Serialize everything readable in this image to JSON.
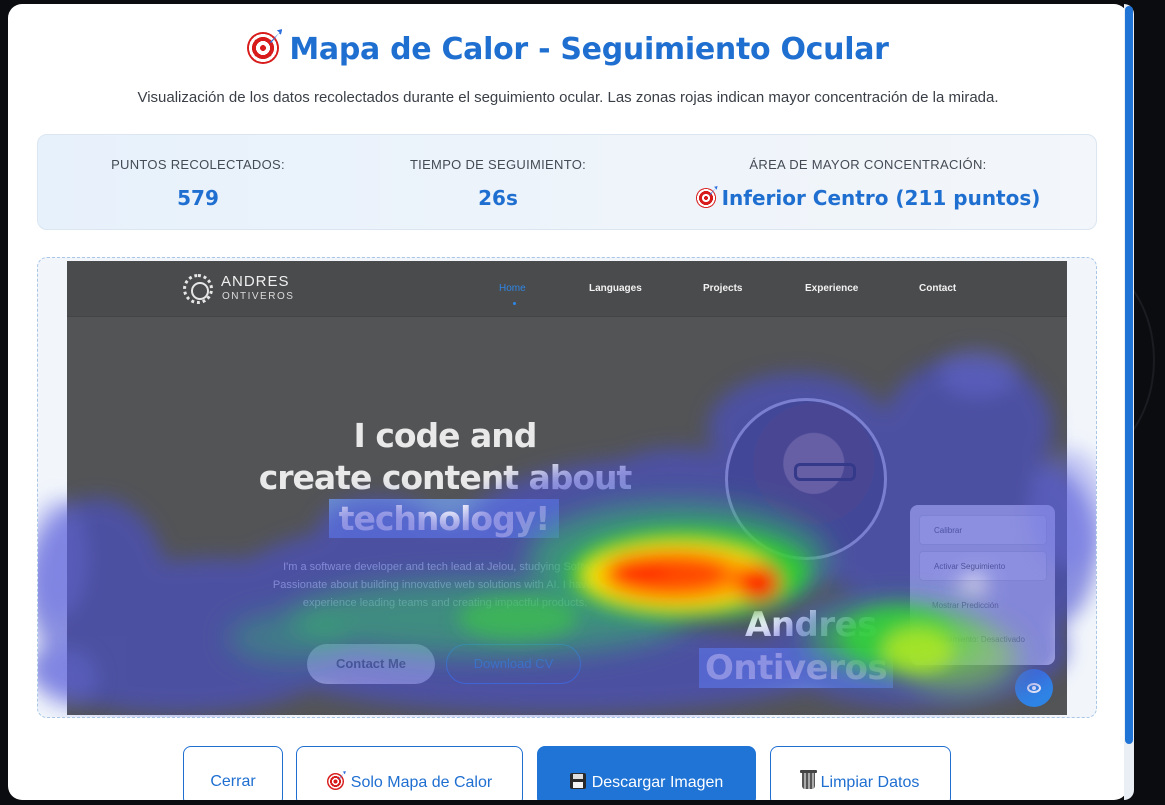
{
  "modal": {
    "title": "Mapa de Calor - Seguimiento Ocular",
    "title_icon": "target-icon",
    "subtitle": "Visualización de los datos recolectados durante el seguimiento ocular. Las zonas rojas indican mayor concentración de la mirada."
  },
  "stats": {
    "points_label": "PUNTOS RECOLECTADOS:",
    "points_value": "579",
    "time_label": "TIEMPO DE SEGUIMIENTO:",
    "time_value": "26s",
    "area_label": "ÁREA DE MAYOR CONCENTRACIÓN:",
    "area_value": "Inferior Centro (211 puntos)"
  },
  "site": {
    "logo_name": "ANDRES",
    "logo_sub": "ONTIVEROS",
    "nav": [
      "Home",
      "Languages",
      "Projects",
      "Experience",
      "Contact"
    ],
    "hero_line1": "I code and",
    "hero_line2": "create content about",
    "hero_line3": "technology!",
    "hero_p1": "I'm a software developer and tech lead at Jelou, studying Software",
    "hero_p2": "Passionate about building innovative web solutions with AI. I have over",
    "hero_p3": "experience leading teams and creating impactful products.",
    "btn_contact": "Contact Me",
    "btn_cv": "Download CV",
    "name_1": "Andres",
    "name_2": "Ontiveros",
    "panel_calibrate": "Calibrar",
    "panel_tracking": "Activar Seguimiento",
    "panel_prediction": "Mostrar Predicción",
    "panel_status": "Seguimiento: Desactivado"
  },
  "actions": {
    "close": "Cerrar",
    "heatmap_only": "Solo Mapa de Calor",
    "download": "Descargar Imagen",
    "clear": "Limpiar Datos"
  },
  "colors": {
    "accent": "#1f6fd1",
    "heat_low": "#4a4fd0",
    "heat_mid": "#2fd02f",
    "heat_high": "#ffe600",
    "heat_peak": "#ff1a00"
  }
}
